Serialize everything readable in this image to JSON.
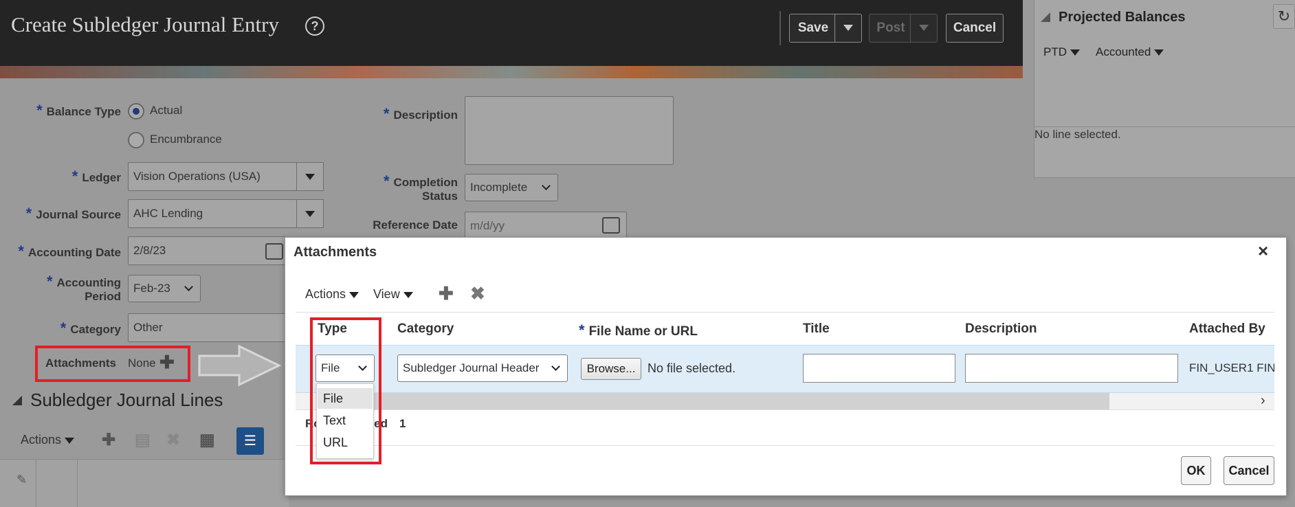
{
  "header": {
    "title": "Create Subledger Journal Entry",
    "help_icon": "?",
    "save": "Save",
    "post": "Post",
    "cancel": "Cancel"
  },
  "projected_balances": {
    "title": "Projected Balances",
    "filter1": "PTD",
    "filter2": "Accounted",
    "empty": "No line selected."
  },
  "form": {
    "balance_type": {
      "label": "Balance Type",
      "options": [
        "Actual",
        "Encumbrance"
      ],
      "selected": "Actual"
    },
    "ledger": {
      "label": "Ledger",
      "value": "Vision Operations (USA)"
    },
    "journal_source": {
      "label": "Journal Source",
      "value": "AHC Lending"
    },
    "accounting_date": {
      "label": "Accounting Date",
      "value": "2/8/23"
    },
    "accounting_period": {
      "label_line1": "Accounting",
      "label_line2": "Period",
      "value": "Feb-23"
    },
    "category": {
      "label": "Category",
      "value": "Other"
    },
    "attachments": {
      "label": "Attachments",
      "value": "None"
    },
    "description": {
      "label": "Description",
      "value": ""
    },
    "completion_status": {
      "label_line1": "Completion",
      "label_line2": "Status",
      "value": "Incomplete"
    },
    "reference_date": {
      "label": "Reference Date",
      "placeholder": "m/d/yy"
    }
  },
  "lines": {
    "title": "Subledger Journal Lines",
    "actions": "Actions"
  },
  "dialog": {
    "title": "Attachments",
    "menu_actions": "Actions",
    "menu_view": "View",
    "columns": [
      "Type",
      "Category",
      "File Name or URL",
      "Title",
      "Description",
      "Attached By"
    ],
    "row": {
      "type": "File",
      "category": "Subledger Journal Header",
      "browse": "Browse...",
      "file_status": "No file selected.",
      "attached_by": "FIN_USER1 FIN"
    },
    "rows_selected_label": "Rows Selected",
    "rows_selected_value": "1",
    "type_options": [
      "File",
      "Text",
      "URL"
    ],
    "ok": "OK",
    "cancel": "Cancel"
  }
}
